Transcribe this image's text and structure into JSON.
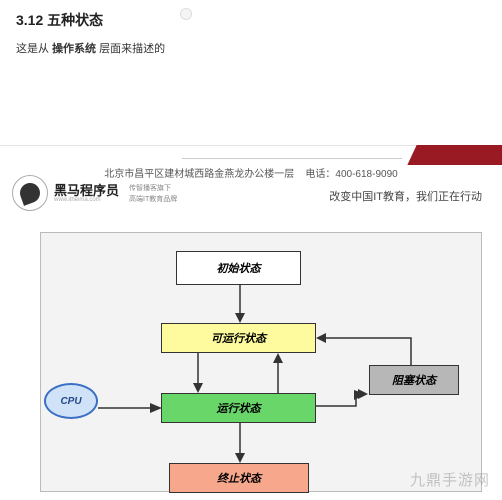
{
  "section": {
    "title": "3.12 五种状态",
    "subtitle_prefix": "这是从 ",
    "subtitle_bold": "操作系统",
    "subtitle_suffix": " 层面来描述的"
  },
  "footer": {
    "address": "北京市昌平区建材城西路金燕龙办公楼一层",
    "phone_label": "电话：",
    "phone": "400-618-9090"
  },
  "brand": {
    "name": "黑马程序员",
    "url": "www.itheima.com",
    "sub1": "传智播客旗下",
    "sub2": "高端IT教育品牌",
    "tagline": "改变中国IT教育，我们正在行动"
  },
  "diagram": {
    "cpu": "CPU",
    "states": {
      "initial": "初始状态",
      "runnable": "可运行状态",
      "running": "运行状态",
      "blocked": "阻塞状态",
      "terminated": "终止状态"
    }
  },
  "watermark": "九鼎手游网"
}
